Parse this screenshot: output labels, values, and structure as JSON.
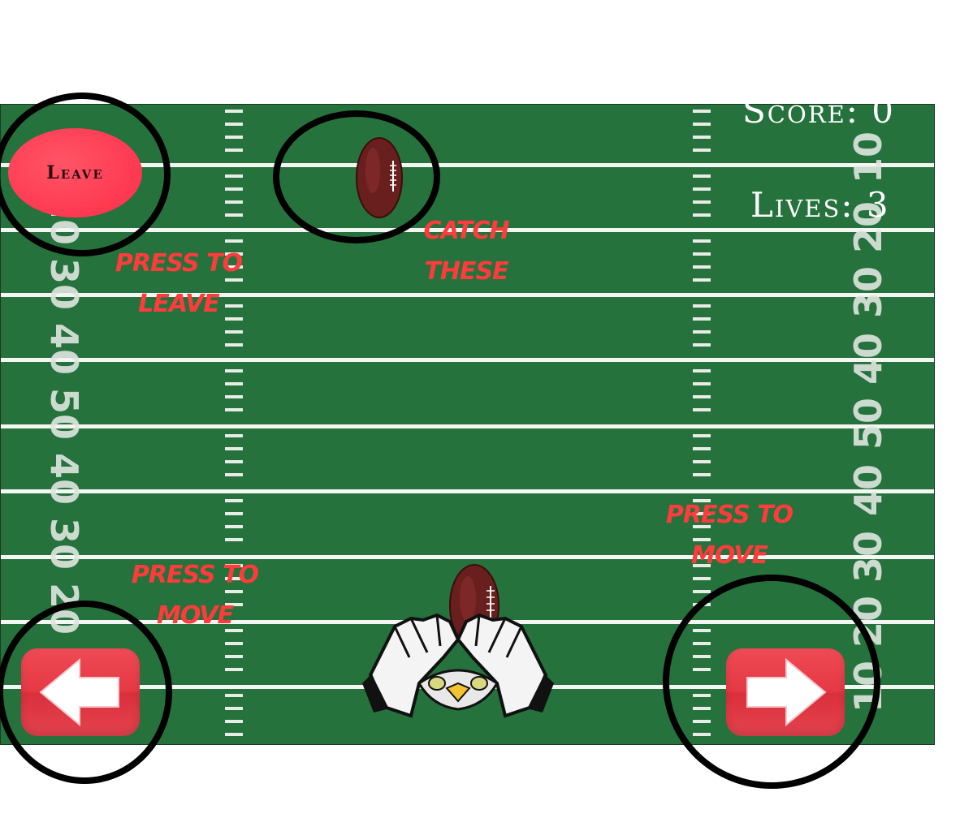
{
  "hud": {
    "score": "Score: 0",
    "lives": "Lives: 3"
  },
  "leave_button": {
    "label": "Leave"
  },
  "hints": {
    "leave_line1": "Press to",
    "leave_line2": "leave",
    "catch_line1": "Catch",
    "catch_line2": "these",
    "left_move_line1": "Press to",
    "left_move_line2": "move",
    "right_move_line1": "Press to",
    "right_move_line2": "move"
  },
  "field": {
    "left_numbers": [
      "20",
      "30",
      "40",
      "50",
      "40",
      "30",
      "20"
    ],
    "right_numbers": [
      "10",
      "20",
      "30",
      "40",
      "50",
      "40",
      "30",
      "20",
      "10"
    ]
  },
  "controls": {
    "left_icon": "left-arrow-icon",
    "right_icon": "right-arrow-icon"
  },
  "colors": {
    "field": "#25723c",
    "hint_text": "#ff3b3b",
    "button_red": "#e63945",
    "leave_button": "#ff3850"
  }
}
